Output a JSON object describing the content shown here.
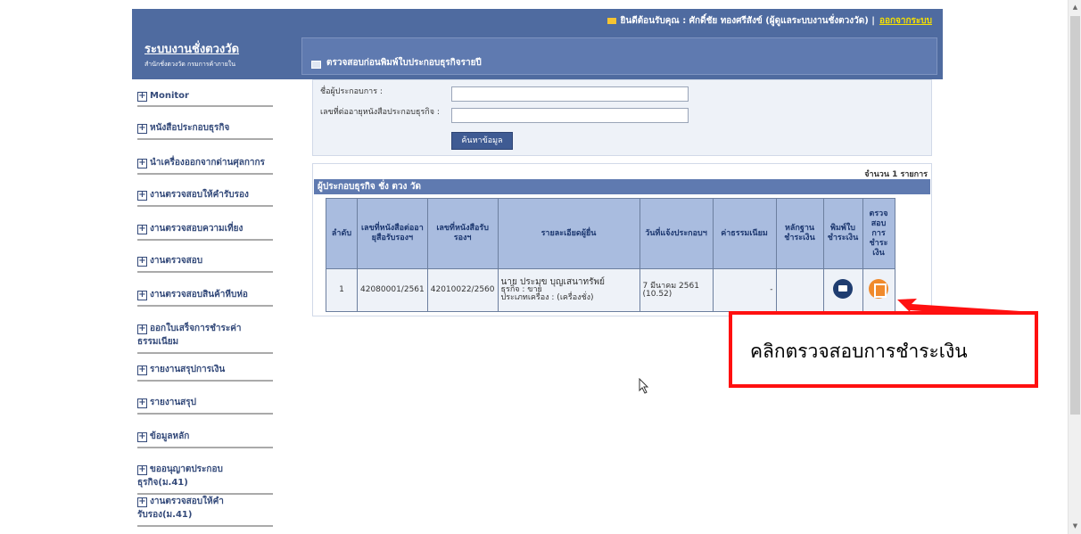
{
  "header": {
    "welcome_text": "ยินดีต้อนรับคุณ : ศักดิ์ชัย ทองศรีสังข์ (ผู้ดูแลระบบงานชั่งตวงวัด) |",
    "logout_label": "ออกจากระบบ",
    "system_title": "ระบบงานชั่งตวงวัด",
    "system_subtitle": "สำนักชั่งตวงวัด กรมการค้าภายใน",
    "page_title": "ตรวจสอบก่อนพิมพ์ใบประกอบธุรกิจรายปี"
  },
  "sidebar": {
    "items": [
      {
        "label": "Monitor"
      },
      {
        "label": "หนังสือประกอบธุรกิจ"
      },
      {
        "label": "นำเครื่องออกจากด่านศุลกากร"
      },
      {
        "label": "งานตรวจสอบให้คำรับรอง"
      },
      {
        "label": "งานตรวจสอบความเที่ยง"
      },
      {
        "label": "งานตรวจสอบ"
      },
      {
        "label": "งานตรวจสอบสินค้าหีบห่อ"
      },
      {
        "label": "ออกใบเสร็จการชำระค่าธรรมเนียม"
      },
      {
        "label": "รายงานสรุปการเงิน"
      },
      {
        "label": "รายงานสรุป"
      },
      {
        "label": "ข้อมูลหลัก"
      },
      {
        "label": "ขออนุญาตประกอบธุรกิจ(ม.41)"
      },
      {
        "label": "งานตรวจสอบให้คำรับรอง(ม.41)"
      }
    ]
  },
  "search": {
    "name_label": "ชื่อผู้ประกอบการ :",
    "name_value": "",
    "license_label": "เลขที่ต่ออายุหนังสือประกอบธุรกิจ :",
    "license_value": "",
    "button_label": "ค้นหาข้อมูล"
  },
  "results": {
    "count_label": "จำนวน 1 รายการ",
    "title": "ผู้ประกอบธุรกิจ ชั่ง ตวง วัด",
    "columns": [
      "ลำดับ",
      "เลขที่หนังสือต่ออายุสือรับรองฯ",
      "เลขที่หนังสือรับรองฯ",
      "รายละเอียดผู้ยื่น",
      "วันที่แจ้งประกอบฯ",
      "ค่าธรรมเนียม",
      "หลักฐานชำระเงิน",
      "พิมพ์ใบชำระเงิน",
      "ตรวจสอบการชำระเงิน"
    ],
    "rows": [
      {
        "no": "1",
        "renew_no": "42080001/2561",
        "cert_no": "42010022/2560",
        "applicant_line1": "นาย ประมุข บุญเสนาทรัพย์",
        "applicant_line2": "ธุรกิจ : ขาย",
        "applicant_line3": "ประเภทเครื่อง : (เครื่องชั่ง)",
        "date": "7 มีนาคม 2561 (10.52)",
        "fee": "-",
        "evidence": "",
        "print_icon": "printer-icon",
        "check_icon": "payment-check-icon"
      }
    ]
  },
  "annotation": {
    "callout_text": "คลิกตรวจสอบการชำระเงิน",
    "color": "#ff1010"
  }
}
